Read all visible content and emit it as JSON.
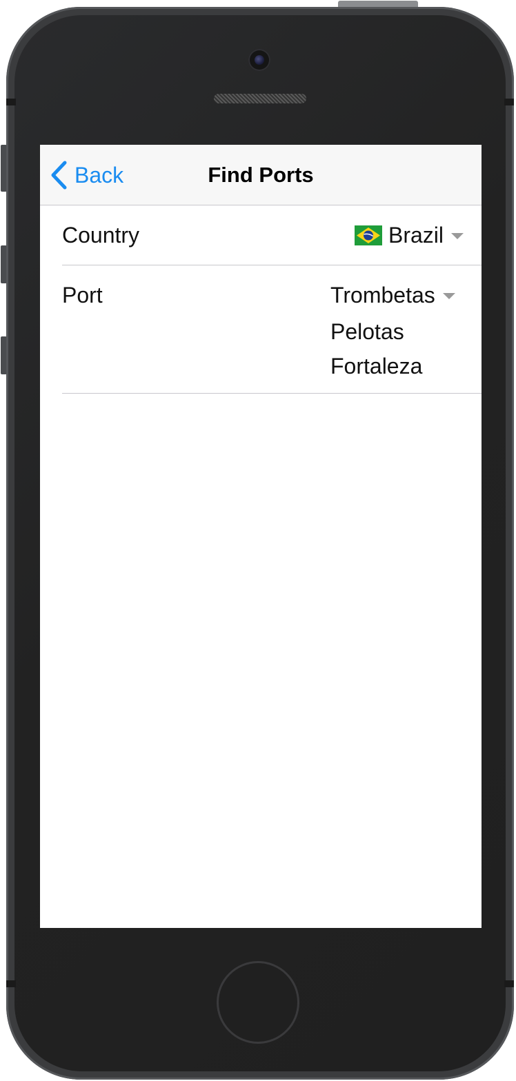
{
  "navbar": {
    "back_label": "Back",
    "title": "Find Ports",
    "tint_color": "#1a8cf0"
  },
  "form": {
    "country": {
      "label": "Country",
      "value": "Brazil",
      "flag_icon": "brazil-flag-icon"
    },
    "port": {
      "label": "Port",
      "selected": "Trombetas",
      "options": [
        "Pelotas",
        "Fortaleza"
      ]
    }
  },
  "icons": {
    "back": "chevron-left-icon",
    "dropdown": "caret-down-icon"
  }
}
